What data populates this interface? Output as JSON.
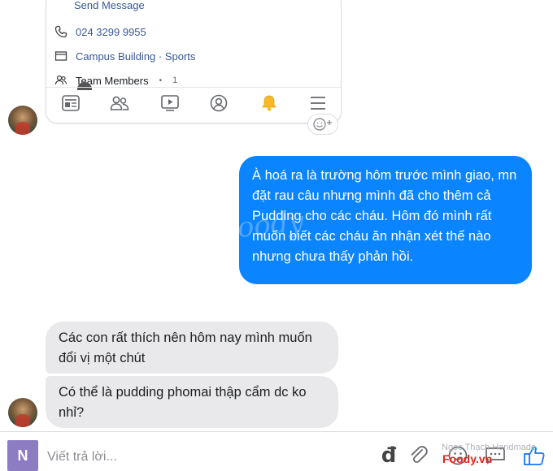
{
  "card": {
    "send_message": "Send Message",
    "phone": "024 3299 9955",
    "category": "Campus Building · Sports",
    "team_members_label": "Team Members",
    "team_members_count": "1",
    "tabs": [
      "feed-icon",
      "people-icon",
      "video-icon",
      "profile-icon",
      "bell-icon",
      "menu-icon"
    ],
    "bell_color": "#f7b928"
  },
  "messages": {
    "outgoing": "À hoá ra là trường hôm trước mình giao, mn đặt rau câu nhưng mình đã cho thêm cả Pudding cho các cháu. Hôm đó mình rất muốn biết các cháu ăn nhận xét thế nào nhưng chưa thấy phản hồi.",
    "incoming": [
      "Các con rất thích nên hôm nay mình muốn đổi vị một chút",
      "Có thể là pudding phomai thập cẩm dc ko nhỉ?"
    ]
  },
  "colors": {
    "outgoing_bubble": "#0a84ff",
    "incoming_bubble": "#e9e9eb",
    "composer_avatar": "#8e7cc3"
  },
  "watermark": "Foody",
  "composer": {
    "avatar_letter": "N",
    "placeholder": "Viết trả lời...",
    "currency_symbol": "đ",
    "overlay_name": "Ngọc Thạch Handmade",
    "brand": "Foody.vn"
  }
}
